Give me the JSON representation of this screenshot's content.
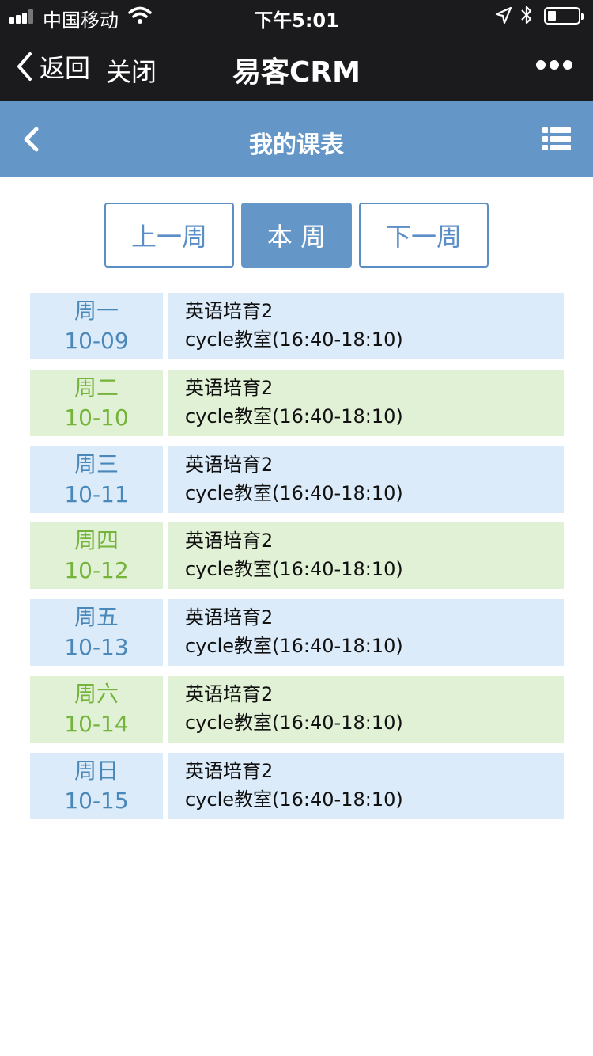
{
  "status_bar": {
    "carrier": "中国移动",
    "time": "下午5:01"
  },
  "wechat_nav": {
    "back_label": "返回",
    "close_label": "关闭",
    "title": "易客CRM"
  },
  "app_header": {
    "title": "我的课表"
  },
  "week_nav": {
    "prev_label": "上一周",
    "current_label": "本 周",
    "next_label": "下一周"
  },
  "schedule": [
    {
      "weekday": "周一",
      "date": "10-09",
      "course": "英语培育2",
      "room_time": "cycle教室(16:40-18:10)",
      "theme": "blue"
    },
    {
      "weekday": "周二",
      "date": "10-10",
      "course": "英语培育2",
      "room_time": "cycle教室(16:40-18:10)",
      "theme": "green"
    },
    {
      "weekday": "周三",
      "date": "10-11",
      "course": "英语培育2",
      "room_time": "cycle教室(16:40-18:10)",
      "theme": "blue"
    },
    {
      "weekday": "周四",
      "date": "10-12",
      "course": "英语培育2",
      "room_time": "cycle教室(16:40-18:10)",
      "theme": "green"
    },
    {
      "weekday": "周五",
      "date": "10-13",
      "course": "英语培育2",
      "room_time": "cycle教室(16:40-18:10)",
      "theme": "blue"
    },
    {
      "weekday": "周六",
      "date": "10-14",
      "course": "英语培育2",
      "room_time": "cycle教室(16:40-18:10)",
      "theme": "green"
    },
    {
      "weekday": "周日",
      "date": "10-15",
      "course": "英语培育2",
      "room_time": "cycle教室(16:40-18:10)",
      "theme": "blue"
    }
  ],
  "colors": {
    "wechat_bar": "#1b1b1d",
    "app_header": "#6497c8",
    "row_blue_bg": "#dbebfa",
    "row_green_bg": "#e1f1d5",
    "day_blue_text": "#4a88b9",
    "day_green_text": "#74b43a"
  },
  "icons": {
    "signal": "cellular-signal-icon",
    "wifi": "wifi-icon",
    "location": "location-arrow-icon",
    "bluetooth": "bluetooth-icon",
    "battery": "battery-icon",
    "back": "chevron-left-icon",
    "more": "more-dots-icon",
    "menu": "list-menu-icon"
  }
}
